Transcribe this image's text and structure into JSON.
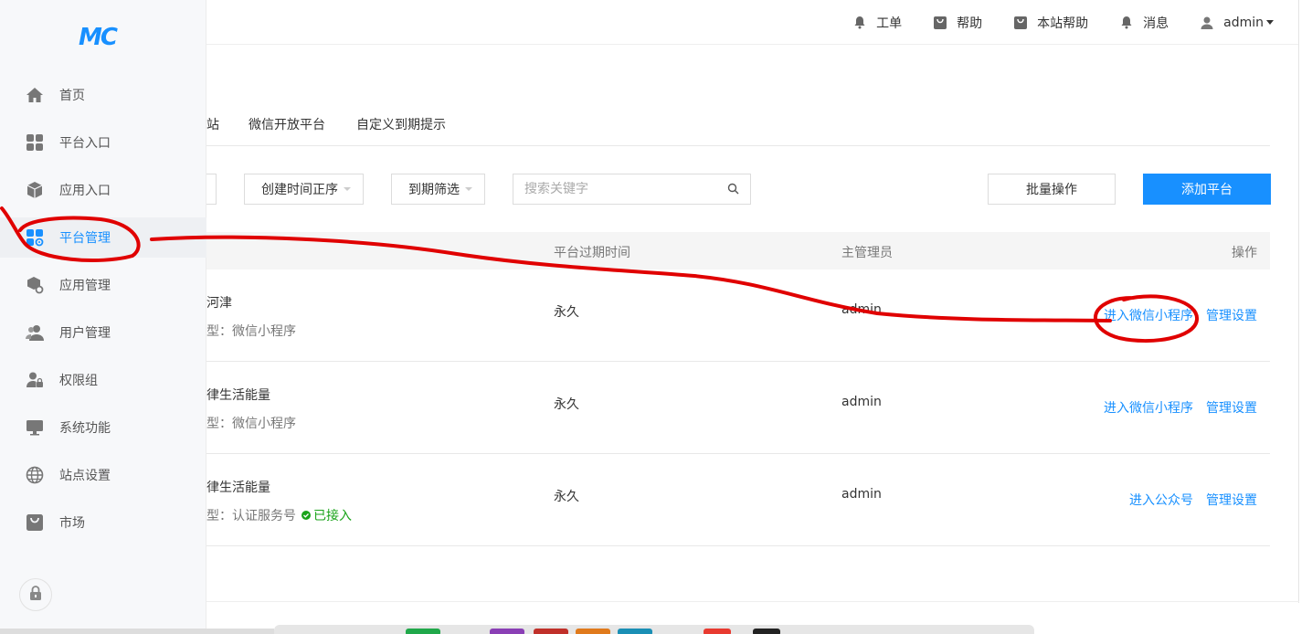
{
  "header": {
    "items": [
      {
        "label": "工单",
        "icon": "bell-icon"
      },
      {
        "label": "帮助",
        "icon": "bag-icon"
      },
      {
        "label": "本站帮助",
        "icon": "bag-icon"
      },
      {
        "label": "消息",
        "icon": "bell-icon"
      },
      {
        "label": "admin",
        "icon": "user-icon"
      }
    ]
  },
  "sidebar": {
    "logo": "MC",
    "items": [
      {
        "label": "首页",
        "icon": "home-icon"
      },
      {
        "label": "平台入口",
        "icon": "grid-icon"
      },
      {
        "label": "应用入口",
        "icon": "cube-icon"
      },
      {
        "label": "平台管理",
        "icon": "grid-gear-icon",
        "active": true
      },
      {
        "label": "应用管理",
        "icon": "cube-gear-icon"
      },
      {
        "label": "用户管理",
        "icon": "users-icon"
      },
      {
        "label": "权限组",
        "icon": "user-lock-icon"
      },
      {
        "label": "系统功能",
        "icon": "monitor-icon"
      },
      {
        "label": "站点设置",
        "icon": "globe-icon"
      },
      {
        "label": "市场",
        "icon": "bag-icon"
      }
    ]
  },
  "tabs": [
    "站",
    "微信开放平台",
    "自定义到期提示"
  ],
  "filters": {
    "sort_select": "创建时间正序",
    "expire_select": "到期筛选",
    "search_placeholder": "搜索关键字",
    "batch_button": "批量操作",
    "add_button": "添加平台"
  },
  "table": {
    "columns": {
      "expire": "平台过期时间",
      "admin": "主管理员",
      "ops": "操作"
    },
    "rows": [
      {
        "name": "河津",
        "type": "型：微信小程序",
        "badge": "",
        "expire": "永久",
        "admin": "admin",
        "enter": "进入微信小程序",
        "manage": "管理设置"
      },
      {
        "name": "律生活能量",
        "type": "型：微信小程序",
        "badge": "",
        "expire": "永久",
        "admin": "admin",
        "enter": "进入微信小程序",
        "manage": "管理设置"
      },
      {
        "name": "律生活能量",
        "type": "型：认证服务号",
        "badge": "已接入",
        "expire": "永久",
        "admin": "admin",
        "enter": "进入公众号",
        "manage": "管理设置"
      }
    ]
  },
  "colors": {
    "accent": "#1890ff",
    "annotation": "#e00000",
    "success": "#19a319"
  }
}
